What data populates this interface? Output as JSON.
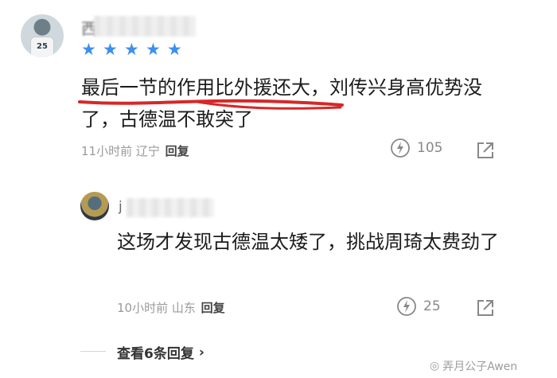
{
  "comment": {
    "username_visible": "西",
    "stars": 5,
    "text": "最后一节的作用比外援还大，刘传兴身高优势没了，古德温不敢突了",
    "time": "11小时前",
    "location": "辽宁",
    "reply_label": "回复",
    "likes": "105",
    "jersey_number": "25"
  },
  "reply": {
    "username_visible": "j",
    "text": "这场才发现古德温太矮了，挑战周琦太费劲了",
    "time": "10小时前",
    "location": "山东",
    "reply_label": "回复",
    "likes": "25"
  },
  "view_more": "查看6条回复",
  "watermark": "弄月公子Awen",
  "colors": {
    "star": "#3d8ef0",
    "underline": "#d62828",
    "meta": "#9a9a9a"
  }
}
